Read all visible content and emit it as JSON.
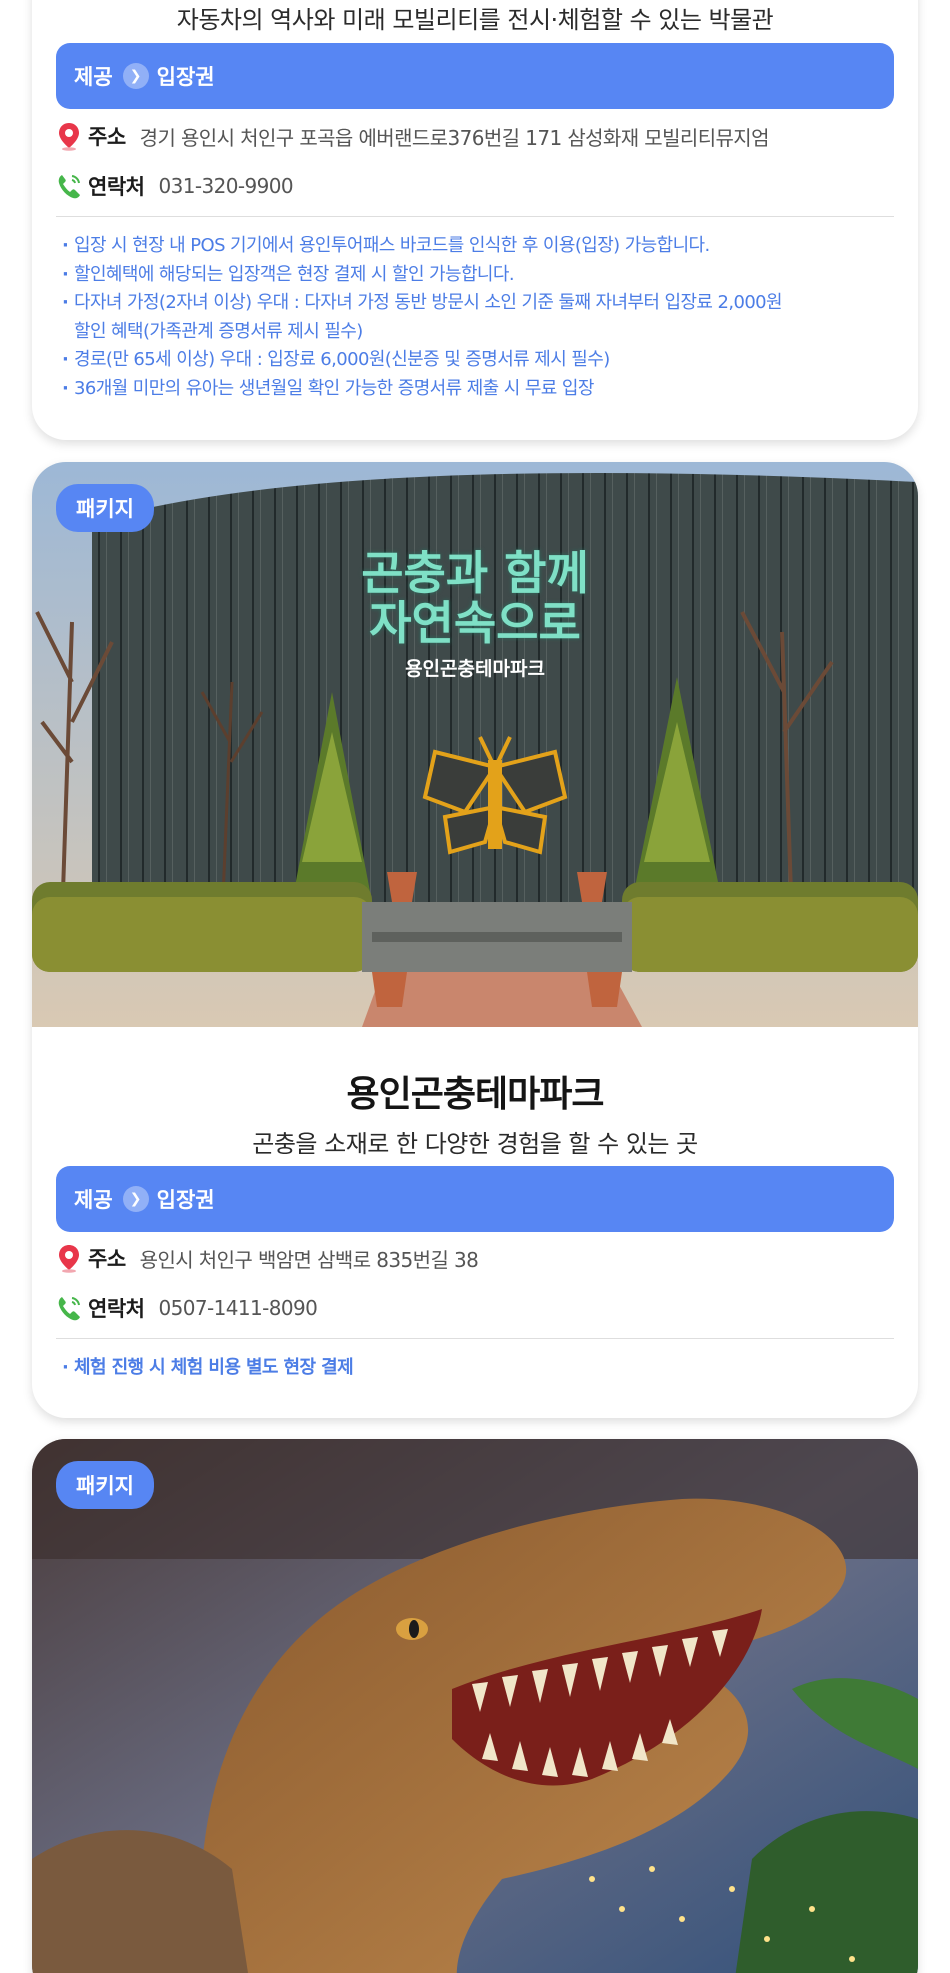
{
  "museum": {
    "subtitle": "자동차의 역사와 미래 모빌리티를 전시·체험할 수 있는 박물관",
    "provide_label": "제공",
    "provide_value": "입장권",
    "address_label": "주소",
    "address": "경기 용인시 처인구 포곡읍 에버랜드로376번길 171 삼성화재 모빌리티뮤지엄",
    "phone_label": "연락처",
    "phone": "031-320-9900",
    "notes": [
      "입장 시 현장 내 POS 기기에서 용인투어패스 바코드를 인식한 후 이용(입장) 가능합니다.",
      "할인혜택에 해당되는 입장객은 현장 결제 시 할인 가능합니다.",
      "다자녀 가정(2자녀 이상) 우대 : 다자녀 가정 동반 방문시 소인 기준 둘째 자녀부터 입장료 2,000원",
      "할인 혜택(가족관계 증명서류 제시 필수)",
      "경로(만 65세 이상) 우대 : 입장료 6,000원(신분증 및 증명서류 제시 필수)",
      "36개월 미만의 유아는 생년월일 확인 가능한 증명서류 제출 시 무료 입장"
    ]
  },
  "insect": {
    "badge": "패키지",
    "sign_line1": "곤충과 함께",
    "sign_line2": "자연속으로",
    "sign_name": "용인곤충테마파크",
    "title": "용인곤충테마파크",
    "subtitle": "곤충을 소재로 한 다양한 경험을 할 수 있는 곳",
    "provide_label": "제공",
    "provide_value": "입장권",
    "address_label": "주소",
    "address": "용인시 처인구 백암면 삼백로 835번길 38",
    "phone_label": "연락처",
    "phone": "0507-1411-8090",
    "notes": [
      "체험 진행 시 체험 비용 별도 현장 결제"
    ]
  },
  "dino": {
    "badge": "패키지"
  },
  "colors": {
    "accent": "#5786f3",
    "note_text": "#4c7de6",
    "pin_red": "#e8364a",
    "phone_green": "#46b64a"
  },
  "icons": {
    "address": "location-pin-icon",
    "phone": "phone-icon",
    "chevron": "chevron-right-icon"
  }
}
